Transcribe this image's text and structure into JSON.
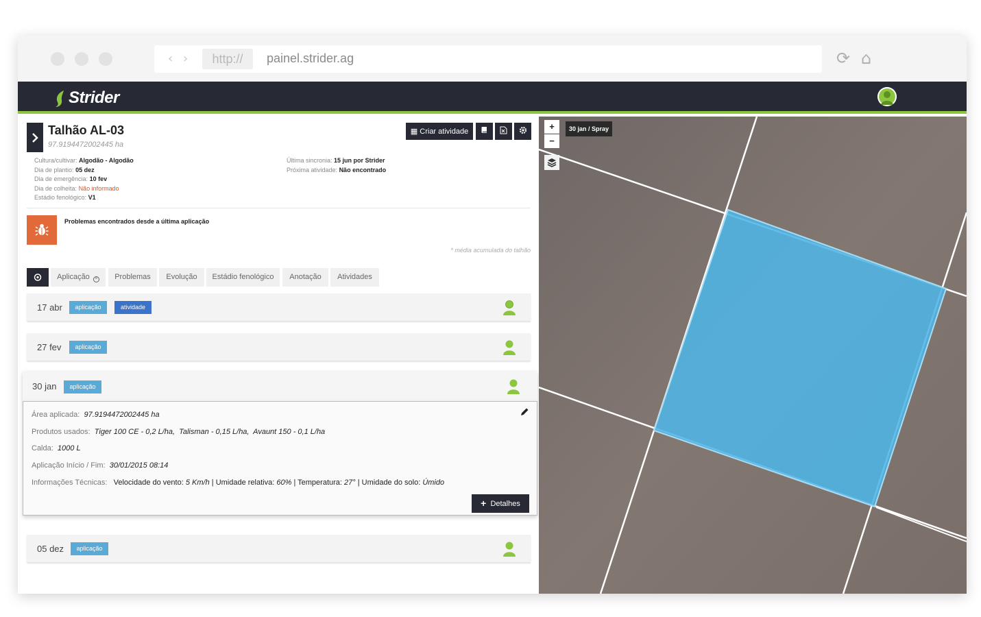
{
  "browser": {
    "protocol": "http://",
    "url": "painel.strider.ag",
    "back_glyph": "‹",
    "forward_glyph": "›",
    "reload_glyph": "⟳",
    "home_glyph": "⌂"
  },
  "app": {
    "logo": "Strider",
    "colors": {
      "nav": "#272a34",
      "accent_green": "#8cc63f",
      "badge_light": "#5aaad8",
      "badge_dark": "#3a73c9",
      "alert_orange": "#e2693a",
      "field_polygon": "#4fb5e6"
    }
  },
  "field": {
    "title": "Talhão AL-03",
    "area": "97.9194472002445 ha",
    "toolbar": {
      "create_activity": "Criar atividade",
      "icons": [
        "calendar-icon",
        "book-icon",
        "excel-file-icon",
        "gear-icon"
      ]
    },
    "info_left": [
      {
        "label": "Cultura/cultivar:",
        "value": "Algodão - Algodão",
        "status": "normal"
      },
      {
        "label": "Dia de plantio:",
        "value": "05 dez",
        "status": "normal"
      },
      {
        "label": "Dia de emergência:",
        "value": "10 fev",
        "status": "normal"
      },
      {
        "label": "Dia de colheita:",
        "value": "Não informado",
        "status": "warning"
      },
      {
        "label": "Estádio fenológico:",
        "value": "V1",
        "status": "normal"
      }
    ],
    "info_right": [
      {
        "label": "Última sincronia:",
        "value": "15 jun por Strider"
      },
      {
        "label": "Próxima atividade:",
        "value": "Não encontrado"
      }
    ],
    "problems_text": "Problemas encontrados desde a última aplicação",
    "avg_note": "* média acumulada do talhão"
  },
  "tabs": [
    "Aplicação",
    "Problemas",
    "Evolução",
    "Estádio fenológico",
    "Anotação",
    "Atividades"
  ],
  "timeline": [
    {
      "date": "17 abr",
      "badges": [
        "aplicação",
        "atividade"
      ]
    },
    {
      "date": "27 fev",
      "badges": [
        "aplicação"
      ]
    },
    {
      "date": "30 jan",
      "badges": [
        "aplicação"
      ],
      "expanded": true
    },
    {
      "date": "05 dez",
      "badges": [
        "aplicação"
      ]
    }
  ],
  "detail": {
    "area_label": "Área aplicada:",
    "area_value": "97.9194472002445 ha",
    "products_label": "Produtos usados:",
    "products_value": "Tiger 100 CE - 0,2 L/ha,  Talisman - 0,15 L/ha,  Avaunt 150 - 0,1 L/ha",
    "calda_label": "Calda:",
    "calda_value": "1000 L",
    "start_end_label": "Aplicação Início / Fim:",
    "start_end_value": "30/01/2015 08:14",
    "tech_label": "Informações Técnicas:",
    "tech_wind_label": "Velocidade do vento:",
    "tech_wind_value": "5 Km/h",
    "tech_humidity_label": "Umidade relativa:",
    "tech_humidity_value": "60%",
    "tech_temp_label": "Temperatura:",
    "tech_temp_value": "27°",
    "tech_soil_label": "Umidade do solo:",
    "tech_soil_value": "Úmido",
    "separator": "|",
    "details_button": "Detalhes"
  },
  "map": {
    "zoom_in": "+",
    "zoom_out": "−",
    "overlay_label": "30 jan / Spray"
  }
}
